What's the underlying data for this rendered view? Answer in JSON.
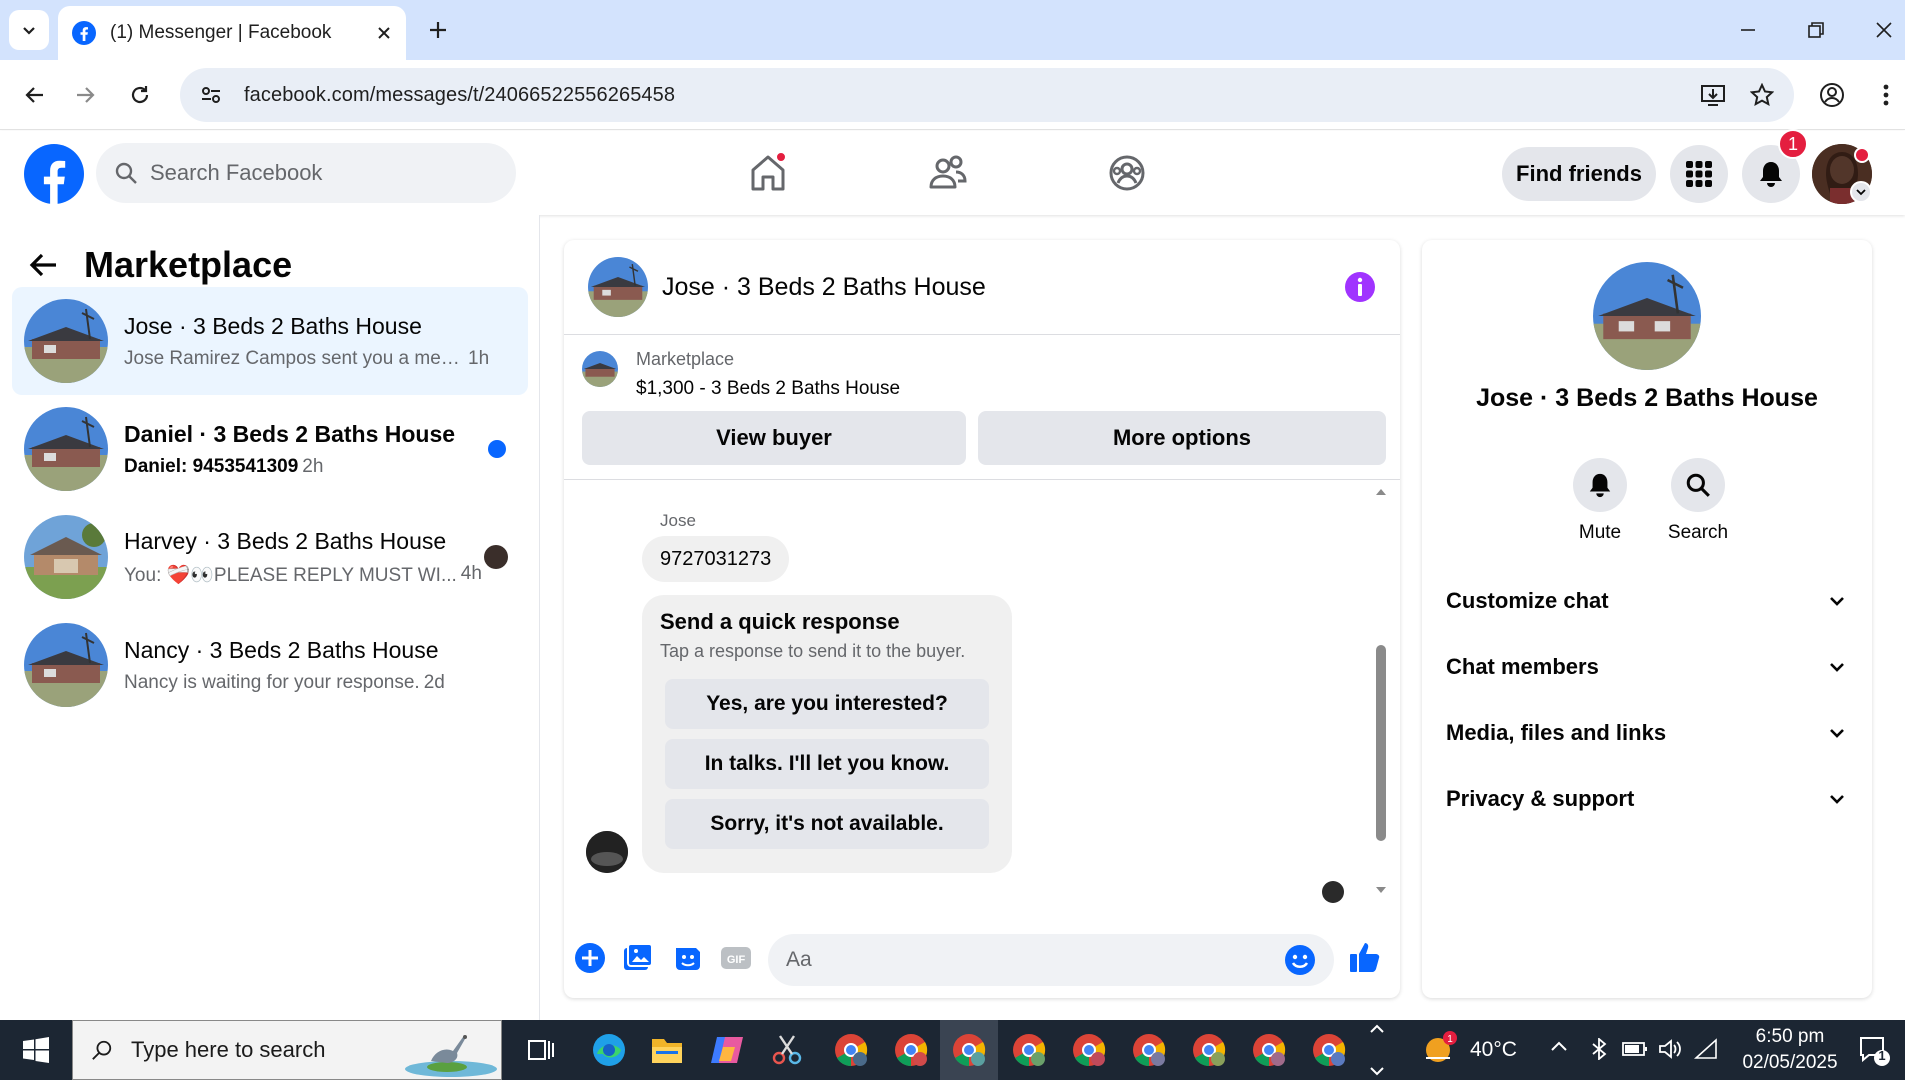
{
  "browser": {
    "tab_title": "(1) Messenger | Facebook",
    "url": "facebook.com/messages/t/24066522556265458"
  },
  "fb": {
    "search_placeholder": "Search Facebook",
    "find_friends": "Find friends",
    "notification_count": "1",
    "brand_color": "#0866ff"
  },
  "left": {
    "title": "Marketplace",
    "conversations": [
      {
        "name": "Jose · 3 Beds 2 Baths House",
        "preview": "Jose Ramirez Campos sent you a mess...",
        "time": "1h",
        "active": true,
        "unread": false
      },
      {
        "name": "Daniel · 3 Beds 2 Baths House",
        "preview": "Daniel: 9453541309",
        "time": "2h",
        "active": false,
        "unread": true
      },
      {
        "name": "Harvey · 3 Beds 2 Baths House",
        "preview": "You: ❤️‍🩹👀PLEASE REPLY MUST WI...",
        "time": "4h",
        "active": false,
        "unread": false
      },
      {
        "name": "Nancy · 3 Beds 2 Baths House",
        "preview": "Nancy is waiting for your response.",
        "time": "2d",
        "active": false,
        "unread": false
      }
    ]
  },
  "chat": {
    "title": "Jose · 3 Beds 2 Baths House",
    "listing_category": "Marketplace",
    "listing_title": "$1,300 - 3 Beds 2 Baths House",
    "view_buyer": "View buyer",
    "more_options": "More options",
    "sender": "Jose",
    "message": "9727031273",
    "quick_heading": "Send a quick response",
    "quick_sub": "Tap a response to send it to the buyer.",
    "quick_replies": [
      "Yes, are you interested?",
      "In talks. I'll let you know.",
      "Sorry, it's not available."
    ],
    "input_placeholder": "Aa"
  },
  "right": {
    "name": "Jose · 3 Beds 2 Baths House",
    "mute": "Mute",
    "search": "Search",
    "sections": [
      "Customize chat",
      "Chat members",
      "Media, files and links",
      "Privacy & support"
    ]
  },
  "taskbar": {
    "search_placeholder": "Type here to search",
    "temperature": "40°C",
    "time": "6:50 pm",
    "date": "02/05/2025",
    "notification_count": "1"
  }
}
